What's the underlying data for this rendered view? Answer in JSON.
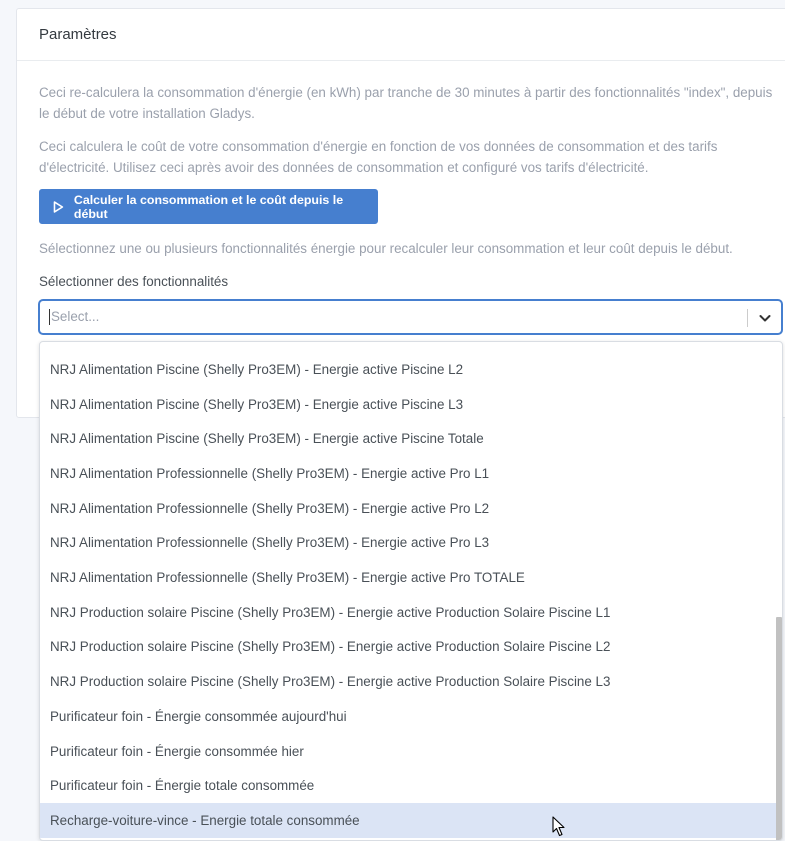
{
  "card": {
    "title": "Paramètres",
    "description_1": "Ceci re-calculera la consommation d'énergie (en kWh) par tranche de 30 minutes à partir des fonctionnalités \"index\", depuis le début de votre installation Gladys.",
    "description_2": "Ceci calculera le coût de votre consommation d'énergie en fonction de vos données de consommation et des tarifs d'électricité. Utilisez ceci après avoir des données de consommation et configuré vos tarifs d'électricité.",
    "calculate_button": "Calculer la consommation et le coût depuis le début",
    "select_hint": "Sélectionnez une ou plusieurs fonctionnalités énergie pour recalculer leur consommation et leur coût depuis le début.",
    "select_label": "Sélectionner des fonctionnalités",
    "select_placeholder": "Select..."
  },
  "options": [
    "NRJ Alimentation Piscine (Shelly Pro3EM) - Energie active Piscine L2",
    "NRJ Alimentation Piscine (Shelly Pro3EM) - Energie active Piscine L3",
    "NRJ Alimentation Piscine (Shelly Pro3EM) - Energie active Piscine Totale",
    "NRJ Alimentation Professionnelle (Shelly Pro3EM) - Energie active Pro L1",
    "NRJ Alimentation Professionnelle (Shelly Pro3EM) - Energie active Pro L2",
    "NRJ Alimentation Professionnelle (Shelly Pro3EM) - Energie active Pro L3",
    "NRJ Alimentation Professionnelle (Shelly Pro3EM) - Energie active Pro TOTALE",
    "NRJ Production solaire Piscine (Shelly Pro3EM) - Energie active Production Solaire Piscine L1",
    "NRJ Production solaire Piscine (Shelly Pro3EM) - Energie active Production Solaire Piscine L2",
    "NRJ Production solaire Piscine (Shelly Pro3EM) - Energie active Production Solaire Piscine L3",
    "Purificateur foin - Énergie consommée aujourd'hui",
    "Purificateur foin - Énergie consommée hier",
    "Purificateur foin - Énergie totale consommée",
    "Recharge-voiture-vince - Energie totale consommée"
  ],
  "highlighted_option_index": 13,
  "icons": {
    "button_icon": "play-outline-icon",
    "dropdown_icon": "chevron-down-icon"
  },
  "colors": {
    "primary": "#467fcf",
    "highlight": "#dbe4f5",
    "muted_text": "#9aa0ac"
  }
}
